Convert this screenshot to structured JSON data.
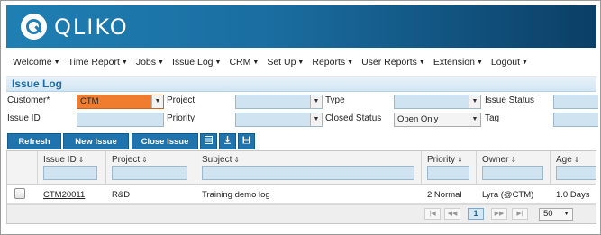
{
  "brand": {
    "name": "QLIKO"
  },
  "nav": {
    "items": [
      {
        "label": "Welcome"
      },
      {
        "label": "Time Report"
      },
      {
        "label": "Jobs"
      },
      {
        "label": "Issue Log"
      },
      {
        "label": "CRM"
      },
      {
        "label": "Set Up"
      },
      {
        "label": "Reports"
      },
      {
        "label": "User Reports"
      },
      {
        "label": "Extension"
      },
      {
        "label": "Logout"
      }
    ],
    "caret": "▼"
  },
  "page": {
    "title": "Issue Log"
  },
  "filters": {
    "customer_label": "Customer*",
    "customer_value": "CTM",
    "project_label": "Project",
    "project_value": "",
    "type_label": "Type",
    "type_value": "",
    "issue_status_label": "Issue Status",
    "issue_status_value": "",
    "issue_id_label": "Issue ID",
    "issue_id_value": "",
    "priority_label": "Priority",
    "priority_value": "",
    "closed_status_label": "Closed Status",
    "closed_status_value": "Open Only",
    "tag_label": "Tag",
    "tag_value": "",
    "dropdown_icon": "▼",
    "highlight_color": "#f07c30"
  },
  "toolbar": {
    "refresh_label": "Refresh",
    "new_issue_label": "New Issue",
    "close_issue_label": "Close Issue",
    "icons": [
      "columns-icon",
      "download-icon",
      "save-icon"
    ]
  },
  "table": {
    "columns": [
      "Issue ID",
      "Project",
      "Subject",
      "Priority",
      "Owner",
      "Age"
    ],
    "sort_icon": "⇕",
    "rows": [
      {
        "issue_id": "CTM20011",
        "project": "R&D",
        "subject": "Training demo log",
        "priority": "2:Normal",
        "owner": "Lyra (@CTM)",
        "age": "1.0 Days"
      }
    ]
  },
  "pagination": {
    "first": "|◀",
    "prev": "◀◀",
    "current_page": "1",
    "next": "▶▶",
    "last": "▶|",
    "page_size": "50"
  },
  "colors": {
    "accent": "#1f74ad",
    "header_dark": "#0b3f66",
    "input_bg": "#cfe3f1"
  }
}
